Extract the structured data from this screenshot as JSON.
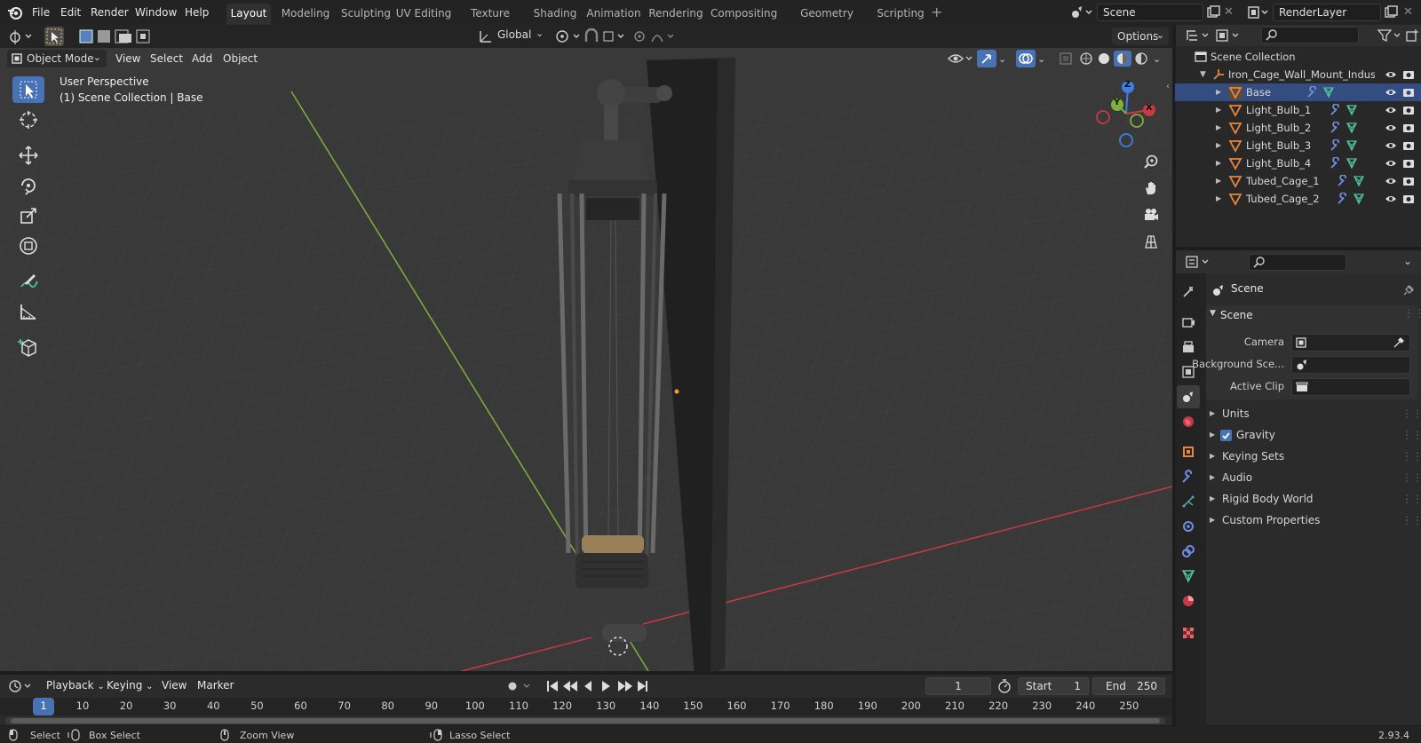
{
  "menu": {
    "file": "File",
    "edit": "Edit",
    "render": "Render",
    "window": "Window",
    "help": "Help"
  },
  "workspaces": [
    "Layout",
    "Modeling",
    "Sculpting",
    "UV Editing",
    "Texture Paint",
    "Shading",
    "Animation",
    "Rendering",
    "Compositing",
    "Geometry Nodes",
    "Scripting"
  ],
  "active_workspace": "Layout",
  "scene_field": "Scene",
  "view_layer_field": "RenderLayer",
  "viewport_header": {
    "transform_orientation": "Global",
    "options": "Options"
  },
  "viewport_menu": {
    "mode": "Object Mode",
    "view": "View",
    "select": "Select",
    "add": "Add",
    "object": "Object"
  },
  "viewport_overlay": {
    "perspective": "User Perspective",
    "collection": "(1) Scene Collection | Base"
  },
  "gizmo": {
    "x": "X",
    "y": "Y",
    "z": "Z"
  },
  "outliner": {
    "root": "Scene Collection",
    "collection": "Iron_Cage_Wall_Mount_Indus",
    "objects": [
      "Base",
      "Light_Bulb_1",
      "Light_Bulb_2",
      "Light_Bulb_3",
      "Light_Bulb_4",
      "Tubed_Cage_1",
      "Tubed_Cage_2"
    ]
  },
  "properties": {
    "context": "Scene",
    "panel": "Scene",
    "fields": {
      "camera": "Camera",
      "background_scene": "Background Sce...",
      "active_clip": "Active Clip"
    },
    "subpanels": [
      "Units",
      "Gravity",
      "Keying Sets",
      "Audio",
      "Rigid Body World",
      "Custom Properties"
    ],
    "gravity_checked": true
  },
  "timeline": {
    "menus": {
      "playback": "Playback",
      "keying": "Keying",
      "view": "View",
      "marker": "Marker"
    },
    "current_frame": "1",
    "start_label": "Start",
    "start": "1",
    "end_label": "End",
    "end": "250",
    "ticks": [
      "1",
      "10",
      "20",
      "30",
      "40",
      "50",
      "60",
      "70",
      "80",
      "90",
      "100",
      "110",
      "120",
      "130",
      "140",
      "150",
      "160",
      "170",
      "180",
      "190",
      "200",
      "210",
      "220",
      "230",
      "240",
      "250"
    ]
  },
  "statusbar": {
    "select": "Select",
    "box_select": "Box Select",
    "zoom_view": "Zoom View",
    "lasso_select": "Lasso Select",
    "version": "2.93.4"
  },
  "colors": {
    "accent": "#4772b3",
    "x_axis": "#c53a44",
    "y_axis": "#7eb03b",
    "z_axis": "#3b7fe0",
    "object_orange": "#e8853e",
    "data_green": "#4fbf9a",
    "modifier_blue": "#6f8fe0",
    "selection": "#334d80"
  }
}
